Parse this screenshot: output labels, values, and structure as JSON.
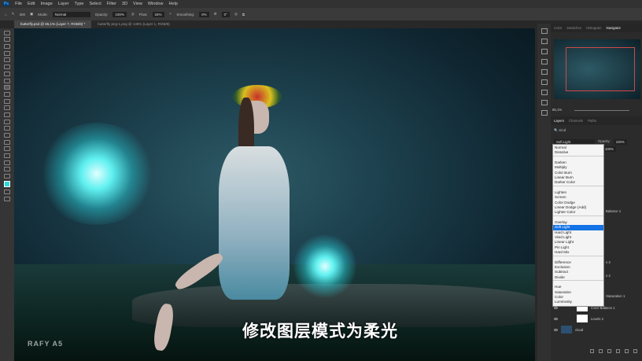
{
  "app": {
    "logo": "Ps"
  },
  "menu": [
    "File",
    "Edit",
    "Image",
    "Layer",
    "Type",
    "Select",
    "Filter",
    "3D",
    "View",
    "Window",
    "Help"
  ],
  "options": {
    "brush_size": "300",
    "mode_label": "Mode:",
    "mode": "Normal",
    "opacity_label": "Opacity:",
    "opacity": "100%",
    "flow_label": "Flow:",
    "flow": "34%",
    "smoothing_label": "Smoothing:",
    "smoothing": "0%",
    "angle": "0°"
  },
  "tabs": [
    {
      "label": "butterfly.psd @ 65,1% (Layer 7, RGB/8) *",
      "active": true
    },
    {
      "label": "butterfly png-1.png @ 145% (Layer 1, RGB/8)",
      "active": false
    }
  ],
  "canvas": {
    "subtitle": "修改图层模式为柔光",
    "watermark": "RAFY A5"
  },
  "panels": {
    "top_tabs": [
      "Color",
      "Swatches",
      "Histogram",
      "Navigator"
    ],
    "navigator_zoom": "65,1%",
    "layer_tabs": [
      "Layers",
      "Channels",
      "Paths"
    ],
    "kind": "Kind",
    "blend_mode": "Soft Light",
    "opacity_label": "Opacity:",
    "opacity": "100%",
    "fill_label": "Fill:",
    "fill": "100%"
  },
  "blend_groups": [
    [
      "Normal",
      "Dissolve"
    ],
    [
      "Darken",
      "Multiply",
      "Color Burn",
      "Linear Burn",
      "Darker Color"
    ],
    [
      "Lighten",
      "Screen",
      "Color Dodge",
      "Linear Dodge (Add)",
      "Lighter Color"
    ],
    [
      "Overlay",
      "Soft Light",
      "Hard Light",
      "Vivid Light",
      "Linear Light",
      "Pin Light",
      "Hard Mix"
    ],
    [
      "Difference",
      "Exclusion",
      "Subtract",
      "Divide"
    ],
    [
      "Hue",
      "Saturation",
      "Color",
      "Luminosity"
    ]
  ],
  "layers": [
    {
      "name": "Balance 1"
    },
    {
      "name": "s 3"
    },
    {
      "name": "s 4"
    },
    {
      "name": "/Saturation 1"
    },
    {
      "name": "Color Balance 1"
    },
    {
      "name": "Levels 2"
    },
    {
      "name": "cloud"
    }
  ],
  "colors": {
    "accent": "#1473e6",
    "glow": "#5ff0f0",
    "navigator_box": "#d04848"
  }
}
